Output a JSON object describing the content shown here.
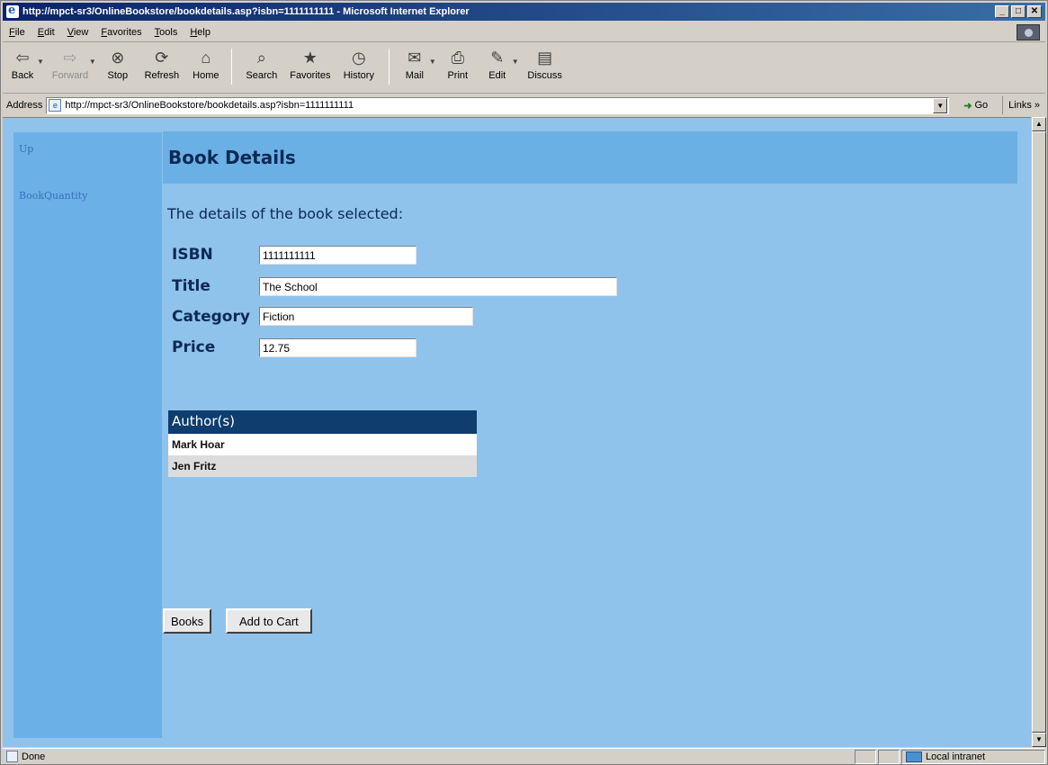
{
  "window": {
    "title": "http://mpct-sr3/OnlineBookstore/bookdetails.asp?isbn=1111111111 - Microsoft Internet Explorer",
    "min_label": "_",
    "max_label": "□",
    "close_label": "✕"
  },
  "menu": {
    "items": [
      {
        "label": "File"
      },
      {
        "label": "Edit"
      },
      {
        "label": "View"
      },
      {
        "label": "Favorites"
      },
      {
        "label": "Tools"
      },
      {
        "label": "Help"
      }
    ]
  },
  "toolbar": {
    "back": {
      "label": "Back",
      "icon": "back-arrow-icon",
      "glyph": "⇦"
    },
    "forward": {
      "label": "Forward",
      "icon": "forward-arrow-icon",
      "glyph": "⇨"
    },
    "stop": {
      "label": "Stop",
      "icon": "stop-icon",
      "glyph": "⊗"
    },
    "refresh": {
      "label": "Refresh",
      "icon": "refresh-icon",
      "glyph": "⟳"
    },
    "home": {
      "label": "Home",
      "icon": "home-icon",
      "glyph": "⌂"
    },
    "search": {
      "label": "Search",
      "icon": "search-icon",
      "glyph": "⌕"
    },
    "favorites": {
      "label": "Favorites",
      "icon": "favorites-icon",
      "glyph": "★"
    },
    "history": {
      "label": "History",
      "icon": "history-icon",
      "glyph": "◷"
    },
    "mail": {
      "label": "Mail",
      "icon": "mail-icon",
      "glyph": "✉"
    },
    "print": {
      "label": "Print",
      "icon": "print-icon",
      "glyph": "⎙"
    },
    "edit": {
      "label": "Edit",
      "icon": "edit-icon",
      "glyph": "✎"
    },
    "discuss": {
      "label": "Discuss",
      "icon": "discuss-icon",
      "glyph": "▤"
    }
  },
  "address": {
    "label": "Address",
    "url": "http://mpct-sr3/OnlineBookstore/bookdetails.asp?isbn=1111111111",
    "go_label": "Go",
    "links_label": "Links »"
  },
  "sidebar": {
    "links": [
      {
        "label": "Up"
      },
      {
        "label": "BookQuantity"
      }
    ]
  },
  "page": {
    "heading": "Book Details",
    "subheading": "The details of the book selected:",
    "fields": {
      "isbn": {
        "label": "ISBN",
        "value": "1111111111"
      },
      "title": {
        "label": "Title",
        "value": "The School"
      },
      "category": {
        "label": "Category",
        "value": "Fiction"
      },
      "price": {
        "label": "Price",
        "value": "12.75"
      }
    },
    "authors": {
      "header": "Author(s)",
      "rows": [
        "Mark Hoar",
        "Jen Fritz"
      ]
    },
    "buttons": {
      "books": "Books",
      "add_to_cart": "Add to Cart"
    }
  },
  "status": {
    "text": "Done",
    "zone": "Local intranet"
  },
  "colors": {
    "page_background": "#8fc3ec",
    "sidebar": "#6cb0e8",
    "heading_bar": "#6bb0e4",
    "heading_text": "#0b2a55",
    "authors_header": "#0e3d6e"
  }
}
